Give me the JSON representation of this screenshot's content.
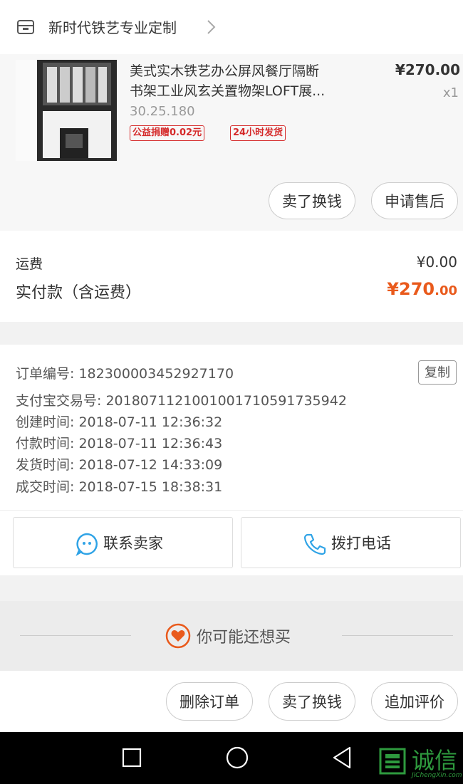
{
  "store": {
    "name": "新时代铁艺专业定制",
    "icon": "store-icon"
  },
  "product": {
    "title_line1": "美式实木铁艺办公屏风餐厅隔断",
    "title_line2": "书架工业风玄关置物架LOFT展...",
    "sku": "30.25.180",
    "tags": [
      "公益捐赠0.02元",
      "24小时发货"
    ],
    "price": "¥270.00",
    "qty": "x1",
    "actions": [
      "卖了换钱",
      "申请售后"
    ]
  },
  "fees": {
    "shipping_label": "运费",
    "shipping_value": "¥0.00",
    "paid_label": "实付款（含运费）",
    "paid_currency": "¥",
    "paid_int": "270",
    "paid_cents": ".00"
  },
  "order_info": {
    "rows": [
      "订单编号: 182300003452927170",
      "支付宝交易号: 2018071121001001710591735942",
      "创建时间: 2018-07-11 12:36:32",
      "付款时间: 2018-07-11 12:36:43",
      "发货时间: 2018-07-12 14:33:09",
      "成交时间: 2018-07-15 18:38:31"
    ],
    "copy_label": "复制"
  },
  "contact": {
    "seller_label": "联系卖家",
    "phone_label": "拨打电话"
  },
  "recommend": {
    "label": "你可能还想买"
  },
  "bottom_actions": [
    "删除订单",
    "卖了换钱",
    "追加评价"
  ],
  "watermark": {
    "text": "诚信",
    "sub": "JiChengXin.com"
  },
  "colors": {
    "accent": "#e95a1c",
    "tag_red": "#d52a2a",
    "chat_blue": "#2fa3e6"
  }
}
